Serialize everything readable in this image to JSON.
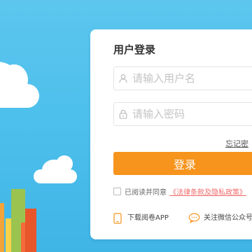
{
  "login": {
    "title": "用户登录",
    "username_placeholder": "请输入用户名",
    "password_placeholder": "请输入密码",
    "forgot_password": "忘记密",
    "submit_label": "登录",
    "agree_text": "已阅读并同意",
    "policy_link": "《法律条款及隐私政策》",
    "download_app": "下载阅卷APP",
    "follow_wechat": "关注微信公众号"
  },
  "icons": {
    "user": "user-icon",
    "lock": "lock-icon",
    "phone": "phone-icon",
    "chat": "chat-bubble-icon"
  },
  "colors": {
    "background": "#4ec0ec",
    "primary_button": "#f7941d",
    "link_red": "#f06a6a",
    "icon_orange": "#f7941d"
  }
}
